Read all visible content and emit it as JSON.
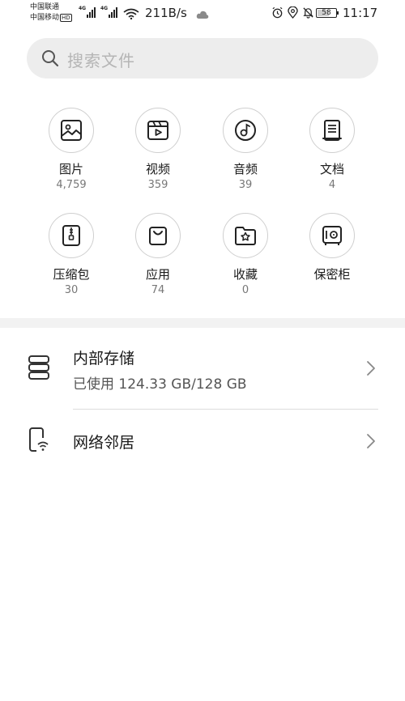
{
  "status_bar": {
    "carrier_1": "中国联通",
    "carrier_2": "中国移动",
    "hd": "HD",
    "net_1": "4G",
    "net_2": "4G",
    "speed": "211B/s",
    "battery": "58",
    "battery_level": 0.58,
    "time": "11:17",
    "icons": [
      "alarm-icon",
      "location-icon",
      "mute-icon"
    ]
  },
  "search": {
    "placeholder": "搜索文件",
    "icon": "search-icon"
  },
  "categories": [
    {
      "label": "图片",
      "count": "4,759",
      "icon": "image-icon"
    },
    {
      "label": "视频",
      "count": "359",
      "icon": "video-icon"
    },
    {
      "label": "音频",
      "count": "39",
      "icon": "audio-icon"
    },
    {
      "label": "文档",
      "count": "4",
      "icon": "document-icon"
    },
    {
      "label": "压缩包",
      "count": "30",
      "icon": "zip-icon"
    },
    {
      "label": "应用",
      "count": "74",
      "icon": "app-bag-icon"
    },
    {
      "label": "收藏",
      "count": "0",
      "icon": "favorites-icon"
    },
    {
      "label": "保密柜",
      "count": "",
      "icon": "safe-icon"
    }
  ],
  "storage_list": [
    {
      "title": "内部存储",
      "subtitle": "已使用 124.33 GB/128 GB",
      "icon": "storage-icon"
    },
    {
      "title": "网络邻居",
      "subtitle": "",
      "icon": "network-device-icon"
    }
  ]
}
